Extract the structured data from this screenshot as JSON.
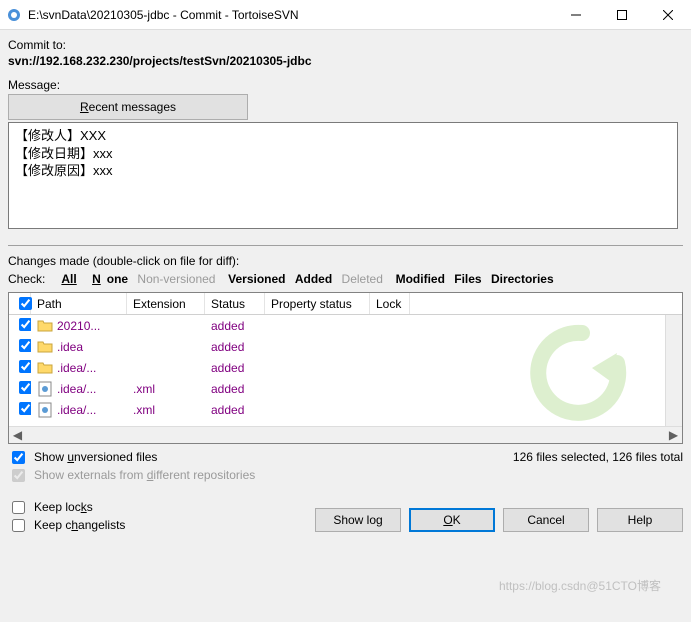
{
  "window": {
    "title": "E:\\svnData\\20210305-jdbc - Commit - TortoiseSVN"
  },
  "commit": {
    "label": "Commit to:",
    "url": "svn://192.168.232.230/projects/testSvn/20210305-jdbc",
    "message_label": "Message:",
    "recent_btn_prefix": "R",
    "recent_btn_rest": "ecent messages",
    "message_text": "【修改人】XXX\n【修改日期】xxx\n【修改原因】xxx"
  },
  "changes": {
    "label": "Changes made (double-click on file for diff):",
    "check_label": "Check:",
    "filters": {
      "all": "All",
      "none": "None",
      "nonversioned": "Non-versioned",
      "versioned": "Versioned",
      "added": "Added",
      "deleted": "Deleted",
      "modified": "Modified",
      "files": "Files",
      "directories": "Directories"
    },
    "headers": {
      "path": "Path",
      "ext": "Extension",
      "status": "Status",
      "prop": "Property status",
      "lock": "Lock"
    },
    "rows": [
      {
        "path": "20210...",
        "ext": "",
        "status": "added",
        "icon": "folder"
      },
      {
        "path": ".idea",
        "ext": "",
        "status": "added",
        "icon": "folder"
      },
      {
        "path": ".idea/...",
        "ext": "",
        "status": "added",
        "icon": "folder"
      },
      {
        "path": ".idea/...",
        "ext": ".xml",
        "status": "added",
        "icon": "xml"
      },
      {
        "path": ".idea/...",
        "ext": ".xml",
        "status": "added",
        "icon": "xml"
      }
    ],
    "status_right": "126 files selected, 126 files total",
    "show_unversioned": "Show unversioned files",
    "show_externals": "Show externals from different repositories"
  },
  "bottom": {
    "keep_locks": "Keep locks",
    "keep_changelists": "Keep changelists",
    "show_log": "Show log",
    "ok": "OK",
    "cancel": "Cancel",
    "help": "Help"
  },
  "watermark": "https://blog.csdn@51CTO博客"
}
